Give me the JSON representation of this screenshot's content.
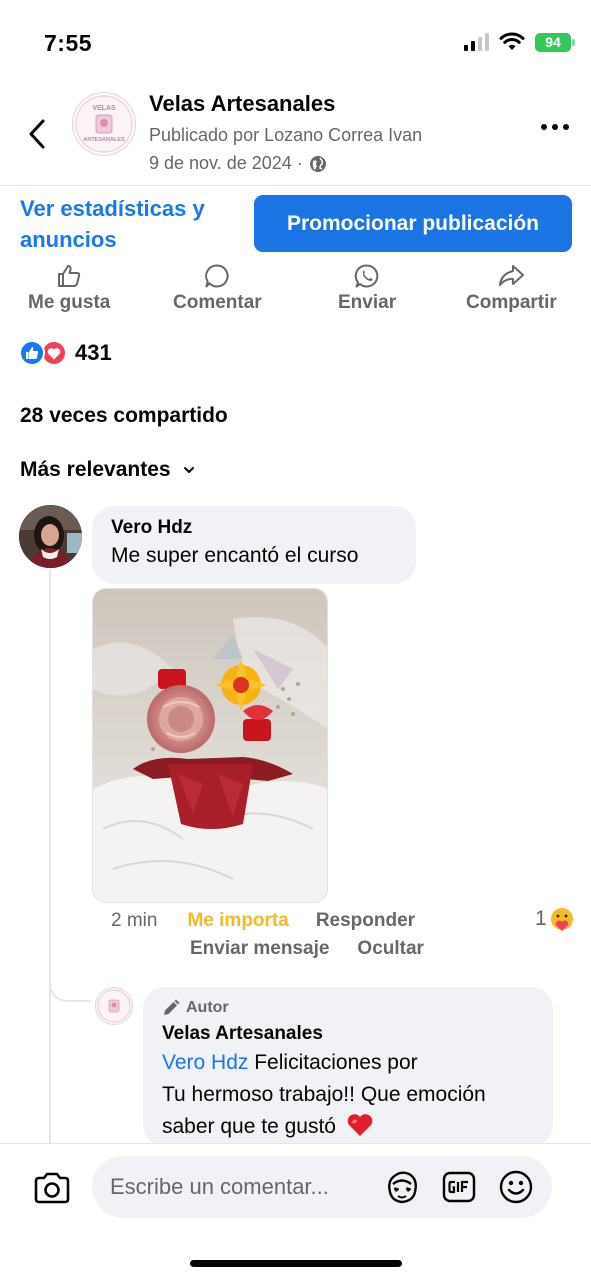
{
  "status_bar": {
    "time": "7:55",
    "battery": "94"
  },
  "post": {
    "page_name": "Velas Artesanales",
    "avatar_text": [
      "VELAS",
      "ARTESANALES"
    ],
    "posted_by": "Publicado por Lozano Correa Ivan",
    "date": "9 de nov. de 2024 ·",
    "stats_link": "Ver estadísticas y anuncios",
    "promote_label": "Promocionar publicación"
  },
  "actions": {
    "like": "Me gusta",
    "comment": "Comentar",
    "send": "Enviar",
    "share": "Compartir"
  },
  "reactions": {
    "count": "431"
  },
  "shares": "28 veces compartido",
  "sort": {
    "label": "Más relevantes"
  },
  "comment": {
    "name": "Vero Hdz",
    "text": "Me super encantó el curso",
    "time": "2 min",
    "love_label": "Me importa",
    "reply_label": "Responder",
    "message_label": "Enviar mensaje",
    "hide_label": "Ocultar",
    "reaction_count": "1"
  },
  "reply": {
    "badge": "Autor",
    "name": "Velas Artesanales",
    "mention": "Vero Hdz",
    "line1": " Felicitaciones por",
    "line2": "Tu hermoso trabajo!! Que emoción",
    "line3": "saber que te gustó"
  },
  "composer": {
    "placeholder": "Escribe un comentar..."
  },
  "colors": {
    "accent": "#1877f2",
    "promote": "#1b74e4",
    "love_text": "#f7b928",
    "love_reaction": "#f33e58",
    "bubble": "#f0f2f5",
    "secondary_text": "#65676b"
  },
  "icons": [
    "back-icon",
    "more-icon",
    "globe-icon",
    "like-icon",
    "comment-icon",
    "whatsapp-icon",
    "share-icon",
    "chevron-down-icon",
    "pencil-icon",
    "heart-emoji-icon",
    "care-reaction-icon",
    "camera-icon",
    "avatar-sticker-icon",
    "gif-icon",
    "emoji-icon"
  ]
}
